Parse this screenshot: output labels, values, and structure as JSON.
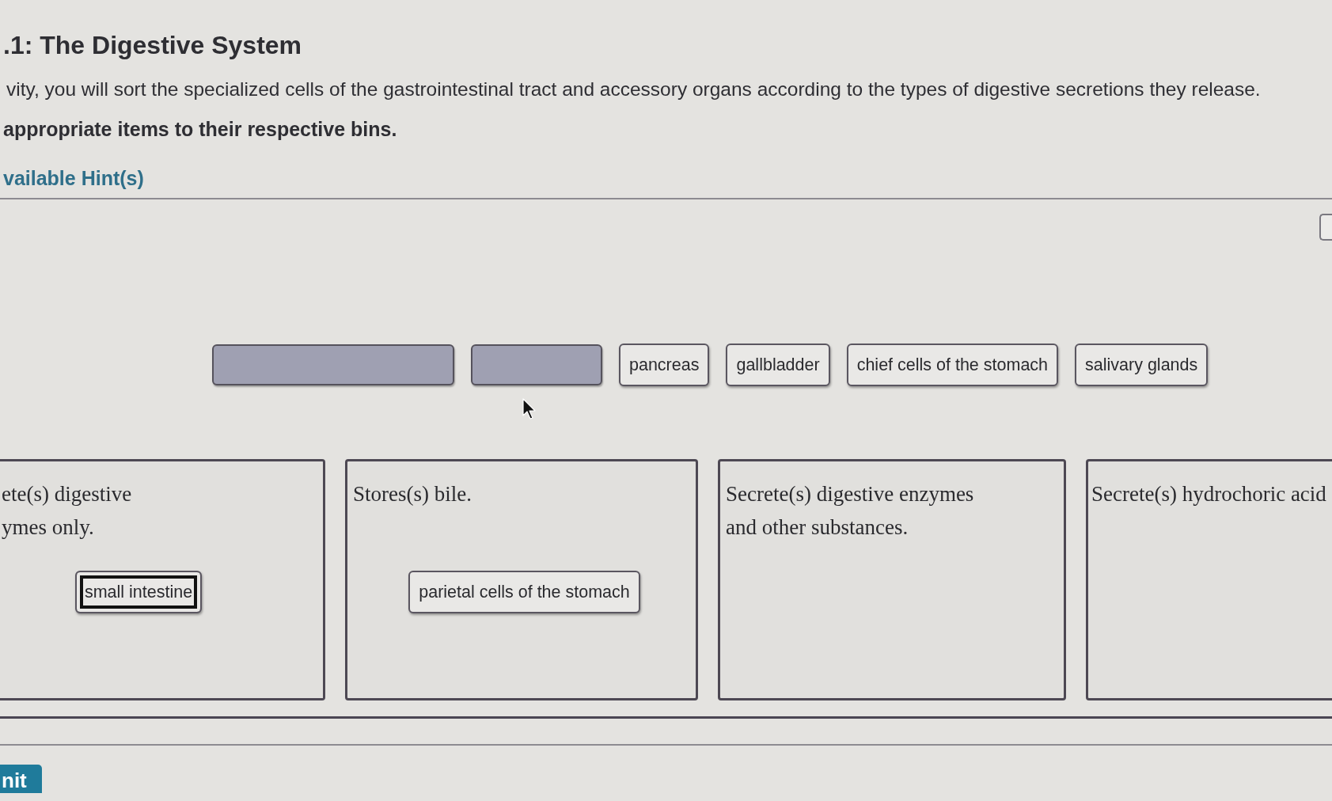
{
  "heading": {
    "title": ".1: The Digestive System",
    "instructions": "vity, you will sort the specialized cells of the gastrointestinal tract and accessory organs according to the types of digestive secretions they release.",
    "task": "appropriate items to their respective bins."
  },
  "hints": {
    "label": "vailable Hint(s)"
  },
  "item_pool": [
    {
      "kind": "slot"
    },
    {
      "kind": "slot"
    },
    {
      "kind": "item",
      "label": "pancreas",
      "selected": false
    },
    {
      "kind": "item",
      "label": "gallbladder",
      "selected": false
    },
    {
      "kind": "item",
      "label": "chief cells of the stomach",
      "selected": false
    },
    {
      "kind": "item",
      "label": "salivary glands",
      "selected": false
    }
  ],
  "bins": [
    {
      "label_lines": [
        "ete(s) digestive",
        "ymes only."
      ],
      "items": [
        {
          "label": "small intestine",
          "selected": true
        }
      ]
    },
    {
      "label_lines": [
        "Stores(s) bile."
      ],
      "items": [
        {
          "label": "parietal cells of the stomach",
          "selected": false
        }
      ]
    },
    {
      "label_lines": [
        "Secrete(s) digestive enzymes",
        "and other substances."
      ]
    },
    {
      "label_lines": [
        "Secrete(s) hydrochoric acid"
      ]
    }
  ],
  "submit_button": {
    "label": "nit"
  }
}
